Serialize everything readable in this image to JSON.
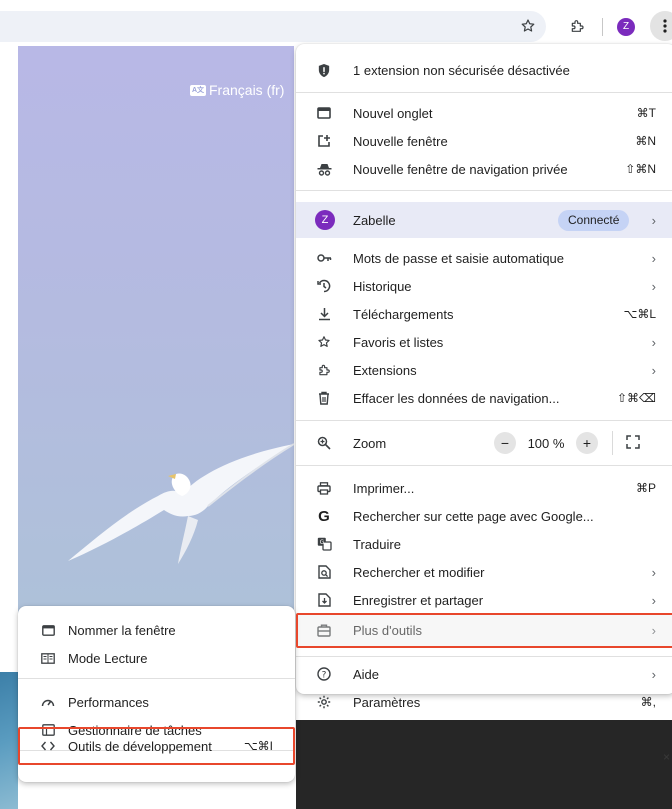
{
  "page": {
    "language_label": "Français (fr)"
  },
  "toolbar": {
    "star_icon": "star-icon",
    "extensions_icon": "puzzle-icon",
    "avatar_letter": "Z"
  },
  "main_menu": {
    "security_notice": "1 extension non sécurisée désactivée",
    "group1": [
      {
        "label": "Nouvel onglet",
        "shortcut": "⌘T",
        "icon": "tab-icon"
      },
      {
        "label": "Nouvelle fenêtre",
        "shortcut": "⌘N",
        "icon": "new-window-icon"
      },
      {
        "label": "Nouvelle fenêtre de navigation privée",
        "shortcut": "⇧⌘N",
        "icon": "incognito-icon"
      }
    ],
    "profile": {
      "letter": "Z",
      "name": "Zabelle",
      "status": "Connecté"
    },
    "group2": [
      {
        "label": "Mots de passe et saisie automatique",
        "shortcut": "",
        "icon": "key-icon"
      },
      {
        "label": "Historique",
        "shortcut": "",
        "icon": "history-icon"
      },
      {
        "label": "Téléchargements",
        "shortcut": "⌥⌘L",
        "icon": "download-icon"
      },
      {
        "label": "Favoris et listes",
        "shortcut": "",
        "icon": "star-icon"
      },
      {
        "label": "Extensions",
        "shortcut": "",
        "icon": "puzzle-icon"
      },
      {
        "label": "Effacer les données de navigation...",
        "shortcut": "⇧⌘⌫",
        "icon": "trash-icon"
      }
    ],
    "zoom": {
      "label": "Zoom",
      "value": "100 %",
      "minus": "−",
      "plus": "+"
    },
    "group3": [
      {
        "label": "Imprimer...",
        "shortcut": "⌘P",
        "icon": "print-icon"
      },
      {
        "label": "Rechercher sur cette page avec Google...",
        "shortcut": "",
        "icon": "google-icon"
      },
      {
        "label": "Traduire",
        "shortcut": "",
        "icon": "translate-icon"
      },
      {
        "label": "Rechercher et modifier",
        "shortcut": "",
        "icon": "find-icon"
      },
      {
        "label": "Enregistrer et partager",
        "shortcut": "",
        "icon": "save-share-icon"
      },
      {
        "label": "Plus d'outils",
        "shortcut": "",
        "icon": "toolbox-icon"
      }
    ],
    "group4": [
      {
        "label": "Aide",
        "shortcut": "",
        "icon": "help-icon"
      },
      {
        "label": "Paramètres",
        "shortcut": "⌘,",
        "icon": "settings-icon"
      }
    ]
  },
  "sub_menu": {
    "items": [
      {
        "label": "Nommer la fenêtre",
        "shortcut": "",
        "icon": "window-icon"
      },
      {
        "label": "Mode Lecture",
        "shortcut": "",
        "icon": "reading-mode-icon"
      },
      {
        "label": "Performances",
        "shortcut": "",
        "icon": "performance-icon"
      },
      {
        "label": "Gestionnaire de tâches",
        "shortcut": "",
        "icon": "task-manager-icon"
      },
      {
        "label": "Outils de développement",
        "shortcut": "⌥⌘I",
        "icon": "code-icon"
      }
    ]
  },
  "colors": {
    "accent": "#7b2bbd",
    "highlight_border": "#e8472c",
    "profile_bg": "#e8eaf6",
    "badge_bg": "#c5d3f5"
  }
}
